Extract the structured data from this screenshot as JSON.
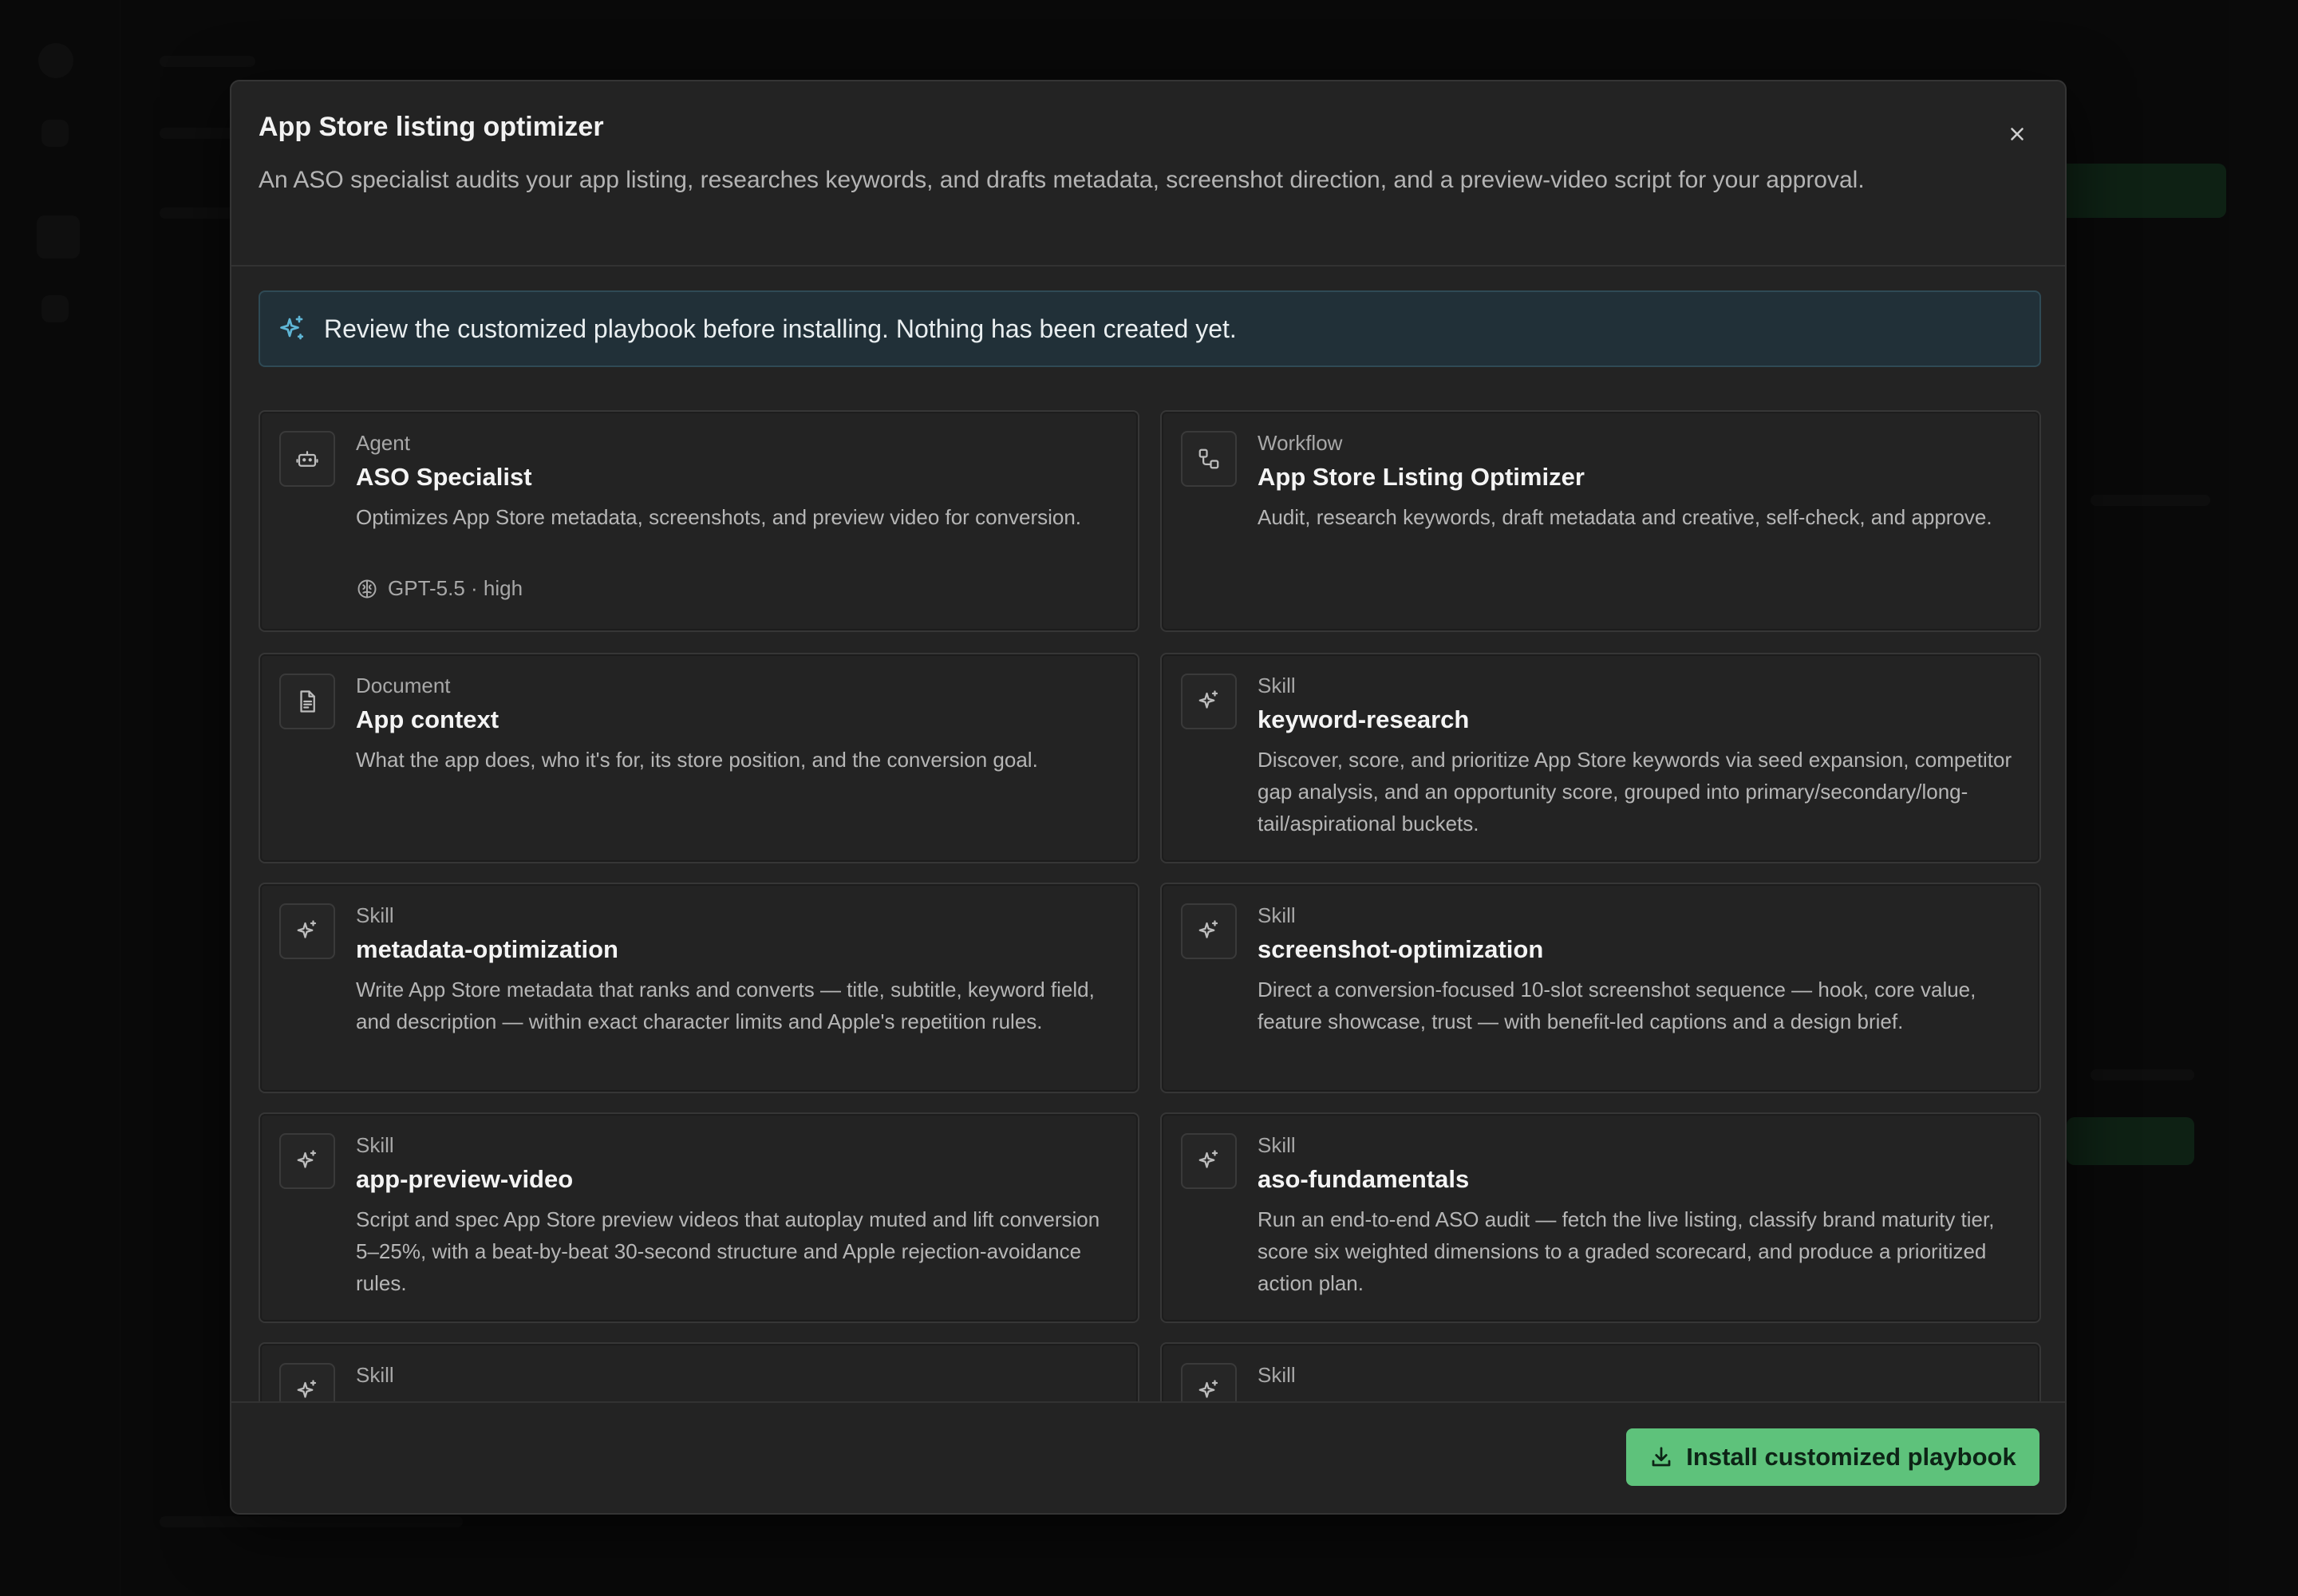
{
  "modal": {
    "title": "App Store listing optimizer",
    "description": "An ASO specialist audits your app listing, researches keywords, and drafts metadata, screenshot direction, and a preview-video script for your approval.",
    "close_icon": "close-icon"
  },
  "notice": {
    "icon": "sparkle-icon",
    "text": "Review the customized playbook before installing. Nothing has been created yet."
  },
  "cards": [
    {
      "type": "Agent",
      "icon": "robot-icon",
      "name": "ASO Specialist",
      "description": "Optimizes App Store metadata, screenshots, and preview video for conversion.",
      "meta": "GPT-5.5 · high",
      "meta_icon": "brain-icon"
    },
    {
      "type": "Workflow",
      "icon": "workflow-icon",
      "name": "App Store Listing Optimizer",
      "description": "Audit, research keywords, draft metadata and creative, self-check, and approve."
    },
    {
      "type": "Document",
      "icon": "document-icon",
      "name": "App context",
      "description": "What the app does, who it's for, its store position, and the conversion goal."
    },
    {
      "type": "Skill",
      "icon": "sparkle-icon",
      "name": "keyword-research",
      "description": "Discover, score, and prioritize App Store keywords via seed expansion, competitor gap analysis, and an opportunity score, grouped into primary/secondary/long-tail/aspirational buckets."
    },
    {
      "type": "Skill",
      "icon": "sparkle-icon",
      "name": "metadata-optimization",
      "description": "Write App Store metadata that ranks and converts — title, subtitle, keyword field, and description — within exact character limits and Apple's repetition rules."
    },
    {
      "type": "Skill",
      "icon": "sparkle-icon",
      "name": "screenshot-optimization",
      "description": "Direct a conversion-focused 10-slot screenshot sequence — hook, core value, feature showcase, trust — with benefit-led captions and a design brief."
    },
    {
      "type": "Skill",
      "icon": "sparkle-icon",
      "name": "app-preview-video",
      "description": "Script and spec App Store preview videos that autoplay muted and lift conversion 5–25%, with a beat-by-beat 30-second structure and Apple rejection-avoidance rules."
    },
    {
      "type": "Skill",
      "icon": "sparkle-icon",
      "name": "aso-fundamentals",
      "description": "Run an end-to-end ASO audit — fetch the live listing, classify brand maturity tier, score six weighted dimensions to a graded scorecard, and produce a prioritized action plan."
    },
    {
      "type": "Skill",
      "icon": "sparkle-icon",
      "name": "",
      "description": ""
    },
    {
      "type": "Skill",
      "icon": "sparkle-icon",
      "name": "",
      "description": ""
    }
  ],
  "footer": {
    "install_label": "Install customized playbook",
    "install_icon": "download-icon"
  }
}
